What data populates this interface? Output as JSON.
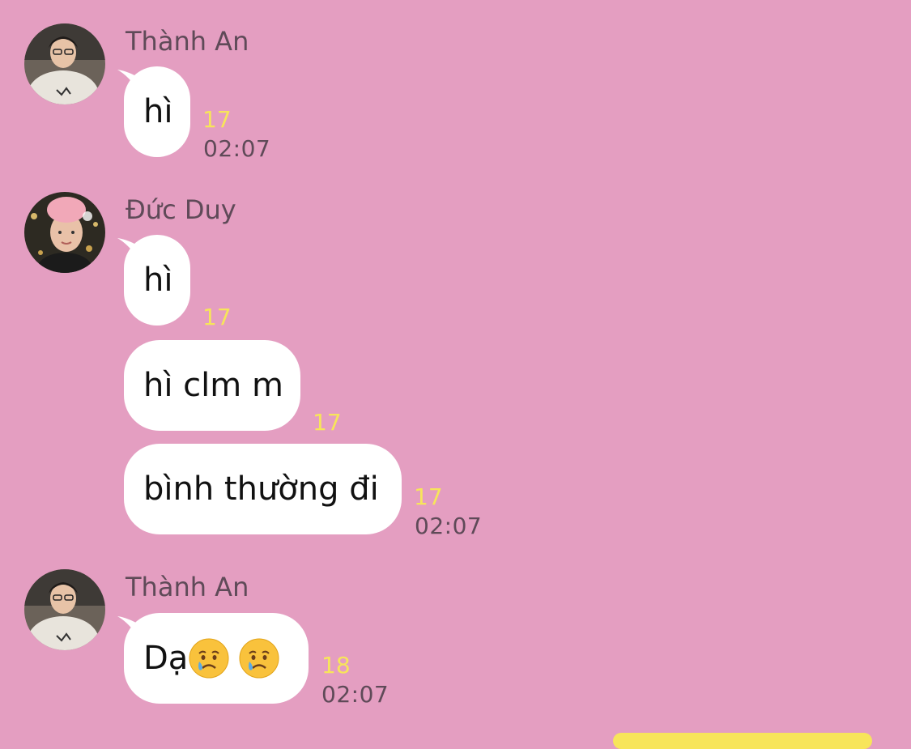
{
  "conversation": {
    "groups": [
      {
        "sender": "Thành An",
        "avatar_icon": "user-avatar-icon",
        "messages": [
          {
            "text": "hì",
            "read_count": "17",
            "time": "02:07"
          }
        ]
      },
      {
        "sender": "Đức Duy",
        "avatar_icon": "user-avatar-icon",
        "messages": [
          {
            "text": "hì",
            "read_count": "17",
            "time": ""
          },
          {
            "text": "hì clm m",
            "read_count": "17",
            "time": ""
          },
          {
            "text": "bình thường đi",
            "read_count": "17",
            "time": "02:07"
          }
        ]
      },
      {
        "sender": "Thành An",
        "avatar_icon": "user-avatar-icon",
        "messages": [
          {
            "text": "Dạ",
            "emoji": [
              "crying-face-icon",
              "crying-face-icon"
            ],
            "read_count": "18",
            "time": "02:07"
          }
        ]
      }
    ]
  },
  "colors": {
    "background": "#e49ec1",
    "bubble": "#ffffff",
    "read_count": "#f7e55a",
    "meta_text": "#5f4a58"
  }
}
